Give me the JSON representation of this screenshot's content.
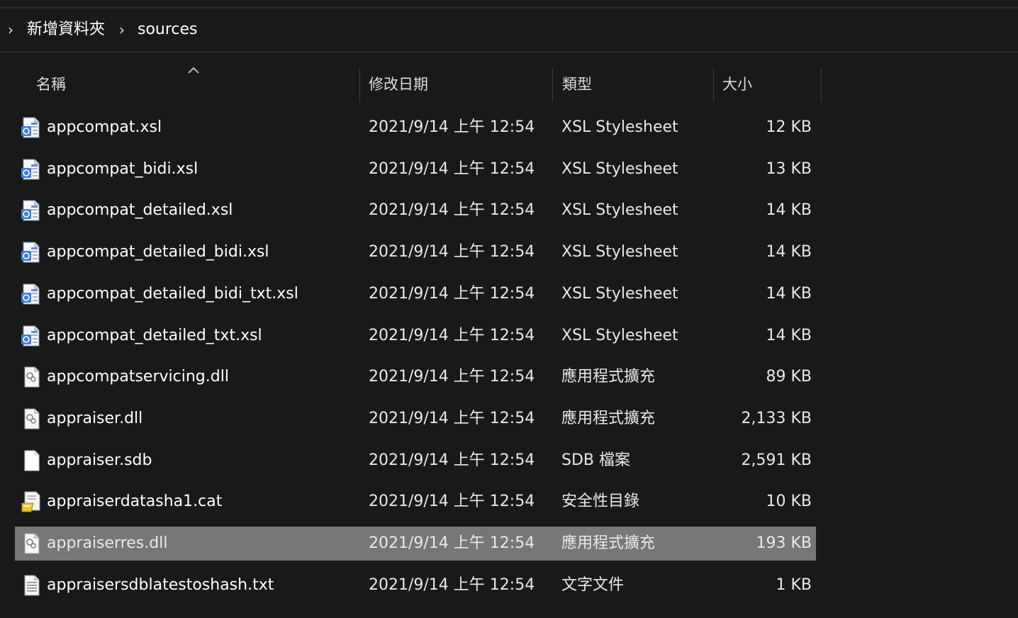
{
  "breadcrumb": {
    "items": [
      {
        "label": "新增資料夾"
      },
      {
        "label": "sources"
      }
    ]
  },
  "columns": {
    "name": "名稱",
    "date": "修改日期",
    "type": "類型",
    "size": "大小"
  },
  "files": [
    {
      "name": "appcompat.xsl",
      "date": "2021/9/14 上午 12:54",
      "type": "XSL Stylesheet",
      "size": "12 KB",
      "icon": "xsl-file-icon"
    },
    {
      "name": "appcompat_bidi.xsl",
      "date": "2021/9/14 上午 12:54",
      "type": "XSL Stylesheet",
      "size": "13 KB",
      "icon": "xsl-file-icon"
    },
    {
      "name": "appcompat_detailed.xsl",
      "date": "2021/9/14 上午 12:54",
      "type": "XSL Stylesheet",
      "size": "14 KB",
      "icon": "xsl-file-icon"
    },
    {
      "name": "appcompat_detailed_bidi.xsl",
      "date": "2021/9/14 上午 12:54",
      "type": "XSL Stylesheet",
      "size": "14 KB",
      "icon": "xsl-file-icon"
    },
    {
      "name": "appcompat_detailed_bidi_txt.xsl",
      "date": "2021/9/14 上午 12:54",
      "type": "XSL Stylesheet",
      "size": "14 KB",
      "icon": "xsl-file-icon"
    },
    {
      "name": "appcompat_detailed_txt.xsl",
      "date": "2021/9/14 上午 12:54",
      "type": "XSL Stylesheet",
      "size": "14 KB",
      "icon": "xsl-file-icon"
    },
    {
      "name": "appcompatservicing.dll",
      "date": "2021/9/14 上午 12:54",
      "type": "應用程式擴充",
      "size": "89 KB",
      "icon": "dll-file-icon"
    },
    {
      "name": "appraiser.dll",
      "date": "2021/9/14 上午 12:54",
      "type": "應用程式擴充",
      "size": "2,133 KB",
      "icon": "dll-file-icon"
    },
    {
      "name": "appraiser.sdb",
      "date": "2021/9/14 上午 12:54",
      "type": "SDB 檔案",
      "size": "2,591 KB",
      "icon": "blank-file-icon"
    },
    {
      "name": "appraiserdatasha1.cat",
      "date": "2021/9/14 上午 12:54",
      "type": "安全性目錄",
      "size": "10 KB",
      "icon": "security-catalog-icon"
    },
    {
      "name": "appraiserres.dll",
      "date": "2021/9/14 上午 12:54",
      "type": "應用程式擴充",
      "size": "193 KB",
      "icon": "dll-file-icon",
      "selected": true
    },
    {
      "name": "appraisersdblatestoshash.txt",
      "date": "2021/9/14 上午 12:54",
      "type": "文字文件",
      "size": "1 KB",
      "icon": "text-file-icon"
    }
  ],
  "colors": {
    "background": "#191919",
    "selected_row": "#777777",
    "text": "#ffffff"
  }
}
